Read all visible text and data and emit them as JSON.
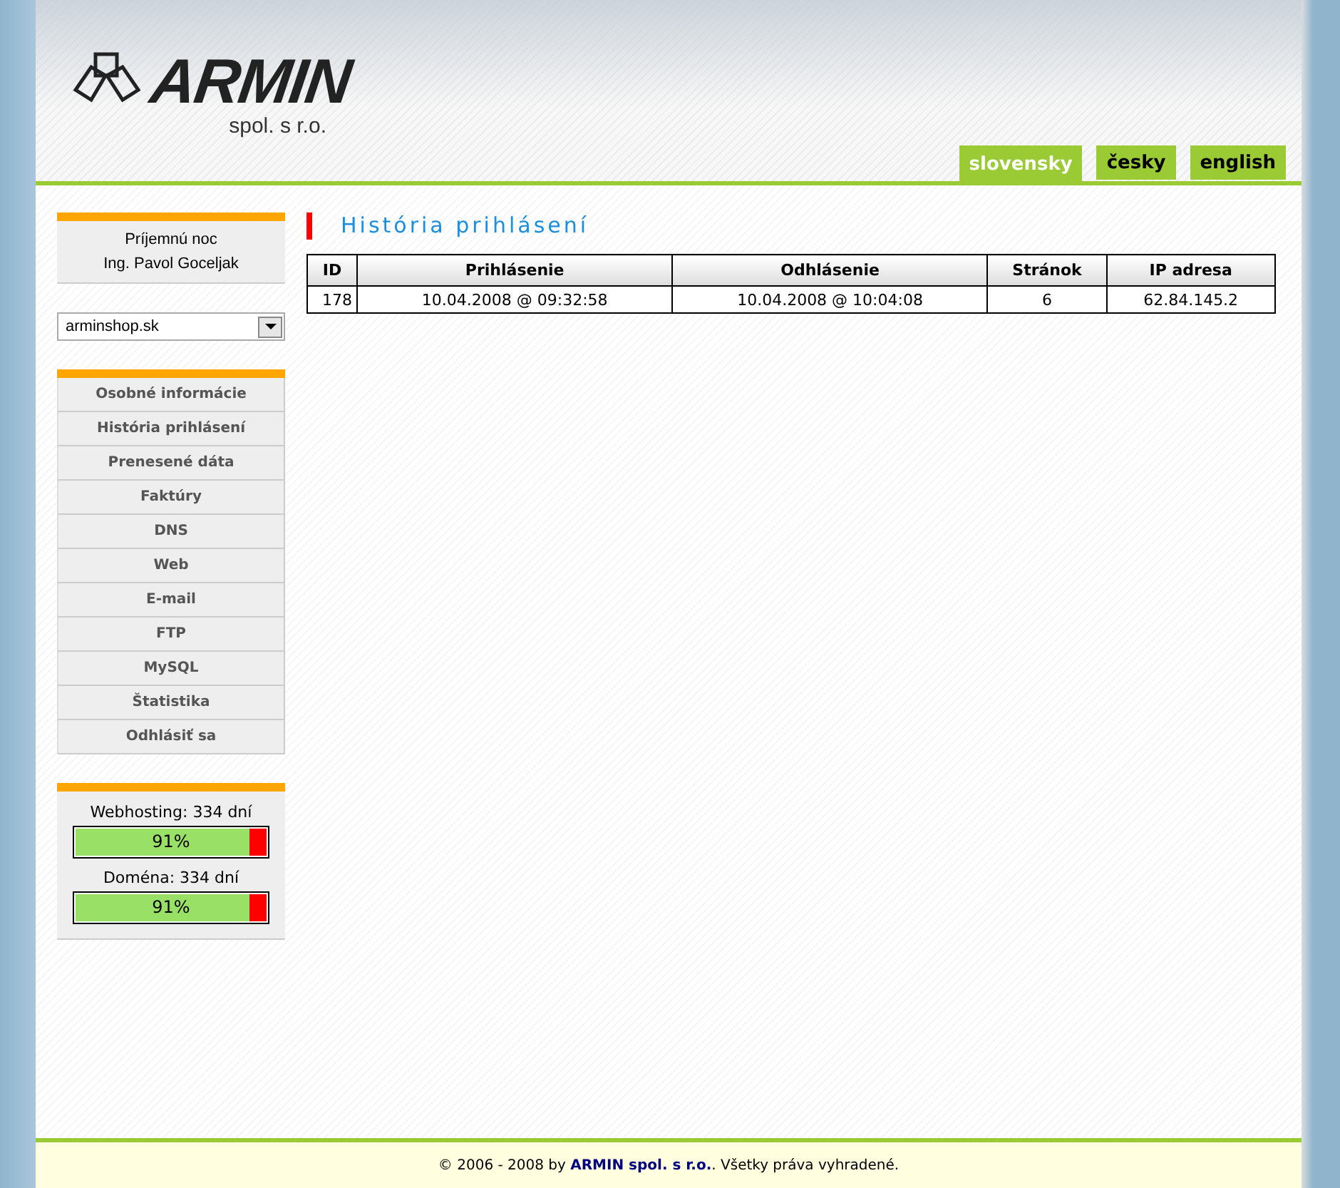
{
  "logo": {
    "name": "ARMIN",
    "subtitle": "spol. s r.o."
  },
  "languages": [
    {
      "label": "slovensky",
      "selected": true
    },
    {
      "label": "česky",
      "selected": false
    },
    {
      "label": "english",
      "selected": false
    }
  ],
  "greeting": {
    "line_1": "Príjemnú noc",
    "line_2": "Ing. Pavol Goceljak"
  },
  "domain_select": {
    "value": "arminshop.sk"
  },
  "menu": [
    "Osobné informácie",
    "História prihlásení",
    "Prenesené dáta",
    "Faktúry",
    "DNS",
    "Web",
    "E-mail",
    "FTP",
    "MySQL",
    "Štatistika",
    "Odhlásiť sa"
  ],
  "quotas": [
    {
      "label": "Webhosting: 334 dní",
      "level": 0.91,
      "reading": "91%"
    },
    {
      "label": "Doména: 334 dní",
      "level": 0.91,
      "reading": "91%"
    }
  ],
  "page_title": "História prihlásení",
  "table": {
    "columns": [
      "ID",
      "Prihlásenie",
      "Odhlásenie",
      "Stránok",
      "IP adresa"
    ],
    "rows": [
      [
        "178",
        "10.04.2008 @ 09:32:58",
        "10.04.2008 @ 10:04:08",
        "6",
        "62.84.145.2"
      ]
    ]
  },
  "footer": {
    "before": "© 2006 - 2008 by ",
    "link": "ARMIN spol. s r.o.",
    "after": ". Všetky práva vyhradené."
  }
}
